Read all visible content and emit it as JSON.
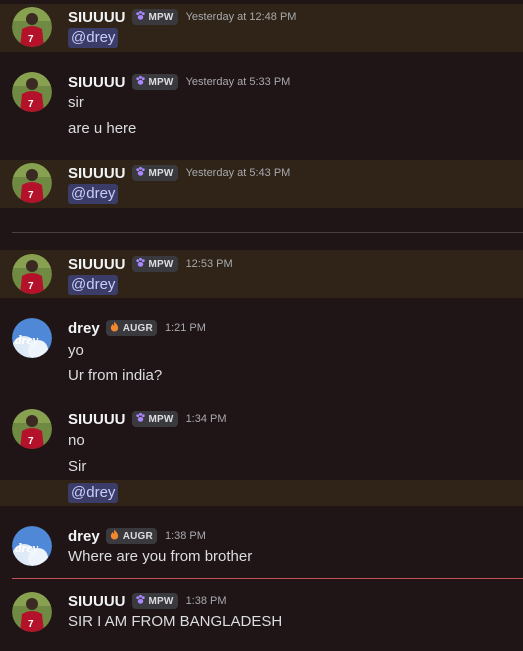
{
  "colors": {
    "background": "#1f1416",
    "mention_highlight": "#2f2417",
    "mention_pill": "#3b3c68",
    "day_divider": "#4a4044",
    "new_messages_divider": "#c94f57"
  },
  "users": {
    "siuuuu": {
      "name": "SIUUUU",
      "tag": "MPW",
      "tag_icon": "purple-paw-icon",
      "avatar": "soccer-player-avatar"
    },
    "drey": {
      "name": "drey",
      "tag": "AUGR",
      "tag_icon": "orange-flame-icon",
      "avatar": "drey-logo-avatar",
      "avatar_text": "drey"
    }
  },
  "messages": [
    {
      "user": "SIUUUU",
      "tag": "MPW",
      "time": "Yesterday at 12:48 PM",
      "mention": "@drey"
    },
    {
      "user": "SIUUUU",
      "tag": "MPW",
      "time": "Yesterday at 5:33 PM",
      "lines": [
        "sir",
        "are u here"
      ]
    },
    {
      "user": "SIUUUU",
      "tag": "MPW",
      "time": "Yesterday at 5:43 PM",
      "mention": "@drey"
    },
    {
      "user": "SIUUUU",
      "tag": "MPW",
      "time": "12:53 PM",
      "mention": "@drey"
    },
    {
      "user": "drey",
      "tag": "AUGR",
      "time": "1:21 PM",
      "lines": [
        "yo",
        "Ur from india?"
      ]
    },
    {
      "user": "SIUUUU",
      "tag": "MPW",
      "time": "1:34 PM",
      "lines": [
        "no",
        "Sir"
      ],
      "mention": "@drey"
    },
    {
      "user": "drey",
      "tag": "AUGR",
      "time": "1:38 PM",
      "lines": [
        "Where are you from brother"
      ]
    },
    {
      "user": "SIUUUU",
      "tag": "MPW",
      "time": "1:38 PM",
      "lines": [
        "SIR I AM FROM BANGLADESH"
      ]
    }
  ]
}
